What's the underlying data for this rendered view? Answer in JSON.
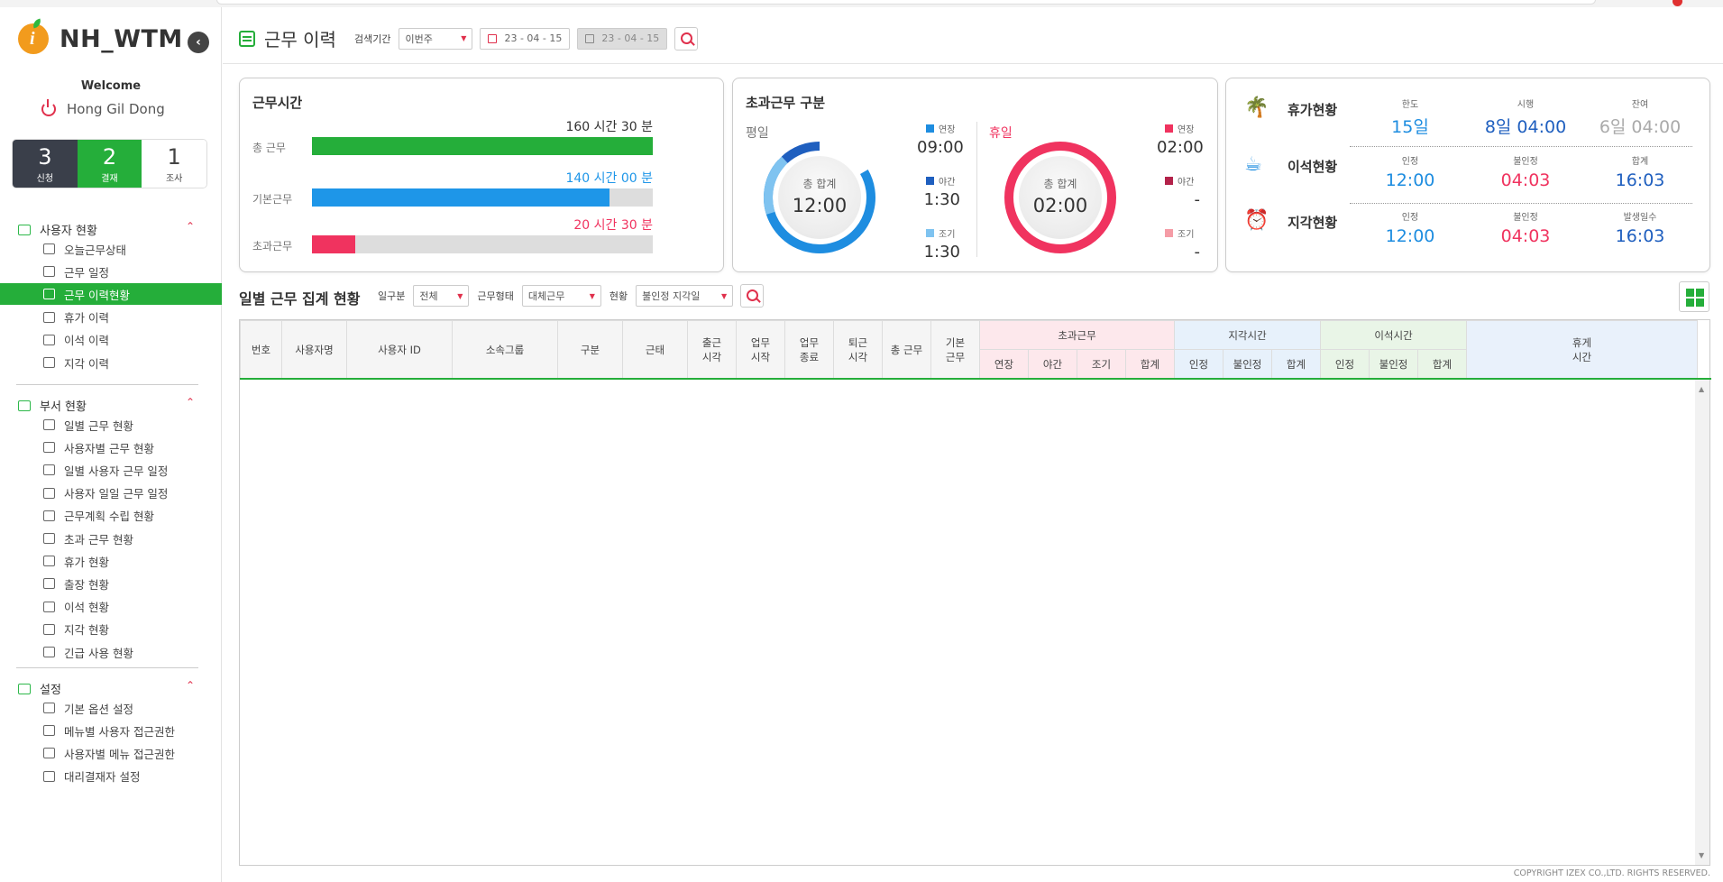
{
  "app": {
    "name": "NH_WTM",
    "welcome": "Welcome",
    "user": "Hong Gil Dong"
  },
  "counters": [
    {
      "num": "3",
      "label": "신청"
    },
    {
      "num": "2",
      "label": "결재"
    },
    {
      "num": "1",
      "label": "조사"
    }
  ],
  "sidebar": {
    "sections": [
      {
        "title": "사용자 현황",
        "items": [
          "오늘근무상태",
          "근무 일정",
          "근무 이력현황",
          "휴가 이력",
          "이석 이력",
          "지각 이력"
        ]
      },
      {
        "title": "부서 현황",
        "items": [
          "일별 근무 현황",
          "사용자별 근무 현황",
          "일별 사용자 근무 일정",
          "사용자 일일 근무 일정",
          "근무계획 수립 현황",
          "초과 근무 현황",
          "휴가 현황",
          "출장 현황",
          "이석 현황",
          "지각 현황",
          "긴급 사용 현황"
        ]
      },
      {
        "title": "설정",
        "items": [
          "기본 옵션 설정",
          "메뉴별 사용자 접근권한",
          "사용자별 메뉴 접근권한",
          "대리결재자 설정"
        ]
      }
    ],
    "active_item": "근무 이력현황"
  },
  "header": {
    "title": "근무 이력",
    "period_label": "검색기간",
    "period_value": "이번주",
    "date_from": "23 - 04 - 15",
    "date_to": "23 - 04 - 15"
  },
  "work_time": {
    "title": "근무시간",
    "rows": [
      {
        "label": "총 근무",
        "value": "160 시간 30 분",
        "fill": 1.0,
        "color": "#25ae3a"
      },
      {
        "label": "기본근무",
        "value": "140 시간 00 분",
        "fill": 0.873,
        "color": "#1e96e8"
      },
      {
        "label": "초과근무",
        "value": "20 시간 30 분",
        "fill": 0.128,
        "color": "#f0335f"
      }
    ]
  },
  "overtime": {
    "title": "초과근무 구분",
    "weekday": {
      "label": "평일",
      "total_label": "총 합계",
      "total": "12:00",
      "legend": [
        {
          "name": "연장",
          "value": "09:00",
          "color": "#1e8de0"
        },
        {
          "name": "야간",
          "value": "1:30",
          "color": "#1f5fbf"
        },
        {
          "name": "조기",
          "value": "1:30",
          "color": "#7fc3f0"
        }
      ]
    },
    "holiday": {
      "label": "휴일",
      "total_label": "총 합계",
      "total": "02:00",
      "legend": [
        {
          "name": "연장",
          "value": "02:00",
          "color": "#f0335f"
        },
        {
          "name": "야간",
          "value": "-",
          "color": "#b3224a"
        },
        {
          "name": "조기",
          "value": "-",
          "color": "#f59ca6"
        }
      ]
    }
  },
  "status": {
    "rows": [
      {
        "name": "휴가현황",
        "icon": "palm-tree-icon",
        "cols": [
          {
            "h": "한도",
            "v": "15일",
            "c": "#1e8de0"
          },
          {
            "h": "시행",
            "v": "8일 04:00",
            "c": "#1f5fbf"
          },
          {
            "h": "잔여",
            "v": "6일 04:00",
            "c": "#aaaaaa"
          }
        ]
      },
      {
        "name": "이석현황",
        "icon": "coffee-icon",
        "cols": [
          {
            "h": "인정",
            "v": "12:00",
            "c": "#1e8de0"
          },
          {
            "h": "불인정",
            "v": "04:03",
            "c": "#f0335f"
          },
          {
            "h": "합계",
            "v": "16:03",
            "c": "#1f5fbf"
          }
        ]
      },
      {
        "name": "지각현황",
        "icon": "alarm-clock-icon",
        "cols": [
          {
            "h": "인정",
            "v": "12:00",
            "c": "#1e8de0"
          },
          {
            "h": "불인정",
            "v": "04:03",
            "c": "#f0335f"
          },
          {
            "h": "발생일수",
            "v": "16:03",
            "c": "#1f5fbf"
          }
        ]
      }
    ]
  },
  "daily": {
    "title": "일별 근무 집계 현황",
    "filters": [
      {
        "label": "일구분",
        "value": "전체"
      },
      {
        "label": "근무형태",
        "value": "대체근무"
      },
      {
        "label": "현황",
        "value": "불인정 지각일"
      }
    ],
    "columns": [
      "번호",
      "사용자명",
      "사용자 ID",
      "소속그룹",
      "구분",
      "근태",
      "출근\n시각",
      "업무\n시작",
      "업무\n종료",
      "퇴근\n시각",
      "총 근무",
      "기본\n근무"
    ],
    "groups": [
      {
        "title": "초과근무",
        "sub": [
          "연장",
          "야간",
          "조기",
          "합계"
        ]
      },
      {
        "title": "지각시간",
        "sub": [
          "인정",
          "불인정",
          "합계"
        ]
      },
      {
        "title": "이석시간",
        "sub": [
          "인정",
          "불인정",
          "합계"
        ]
      }
    ],
    "rest_col": "휴게\n시간"
  },
  "footer": {
    "copyright": "COPYRIGHT IZEX CO.,LTD. RIGHTS RESERVED."
  }
}
